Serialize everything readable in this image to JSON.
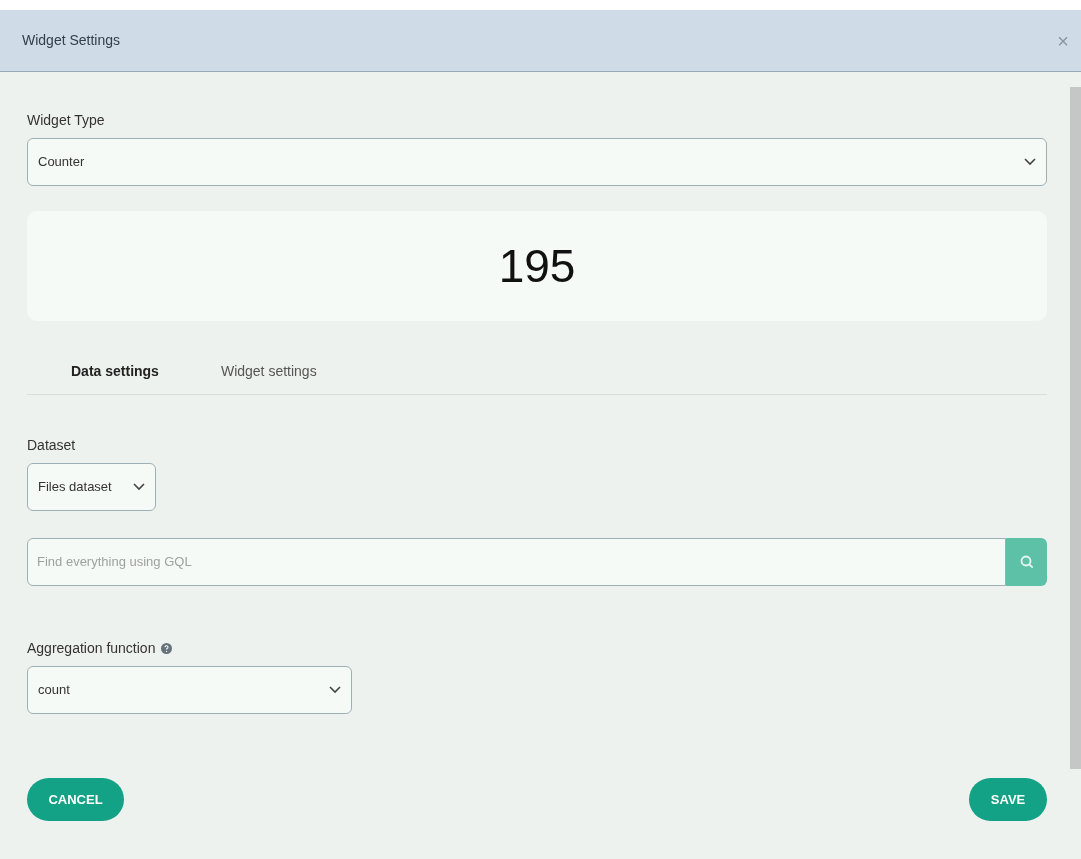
{
  "dialog": {
    "title": "Widget Settings",
    "close": "×"
  },
  "widget_type": {
    "label": "Widget Type",
    "value": "Counter"
  },
  "preview": {
    "value": "195"
  },
  "tabs": [
    {
      "label": "Data settings",
      "selected": true
    },
    {
      "label": "Widget settings",
      "selected": false
    }
  ],
  "dataset": {
    "label": "Dataset",
    "value": "Files dataset"
  },
  "search": {
    "placeholder": "Find everything using GQL"
  },
  "aggregation": {
    "label": "Aggregation function",
    "value": "count"
  },
  "buttons": {
    "cancel": "CANCEL",
    "save": "SAVE"
  }
}
